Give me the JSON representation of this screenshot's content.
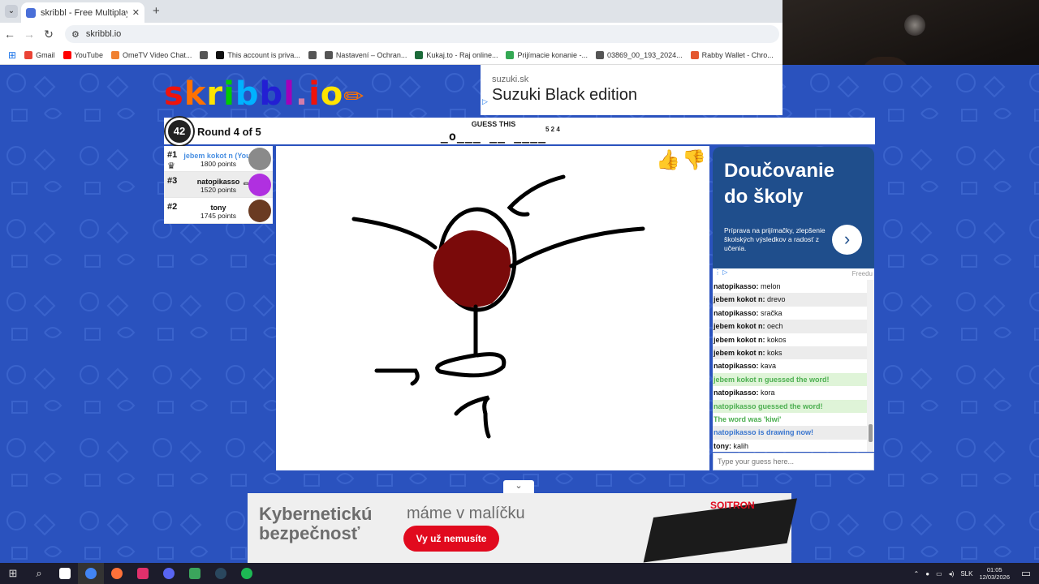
{
  "browser": {
    "tab_title": "skribbl - Free Multiplayer Draw",
    "tab_close": "✕",
    "new_tab": "+",
    "url": "skribbl.io",
    "bookmarks": [
      {
        "label": "Gmail",
        "color": "#ea4335"
      },
      {
        "label": "YouTube",
        "color": "#ff0000"
      },
      {
        "label": "OmeTV Video Chat...",
        "color": "#f08030"
      },
      {
        "label": "",
        "color": "#555555"
      },
      {
        "label": "This account is priva...",
        "color": "#111111"
      },
      {
        "label": "",
        "color": "#555555"
      },
      {
        "label": "Nastavení – Ochran...",
        "color": "#555555"
      },
      {
        "label": "Kukaj.to - Raj online...",
        "color": "#1d6b3a"
      },
      {
        "label": "Prijímacie konanie -...",
        "color": "#34a853"
      },
      {
        "label": "03869_00_193_2024...",
        "color": "#555555"
      },
      {
        "label": "Rabby Wallet - Chro...",
        "color": "#e4572e"
      }
    ]
  },
  "logo": {
    "letters": [
      "s",
      "k",
      "r",
      "i",
      "b",
      "b",
      "l",
      ".",
      "i",
      "o"
    ],
    "pencil": "✏"
  },
  "top_ad": {
    "domain": "suzuki.sk",
    "headline": "Suzuki Black edition"
  },
  "game": {
    "timer": "42",
    "round": "Round 4 of 5",
    "guess_label": "GUESS THIS",
    "word_hint": "_o___ __ ____",
    "word_lengths": "5 2 4"
  },
  "players": [
    {
      "rank": "#1",
      "name": "jebem kokot n (You)",
      "points": "1800 points",
      "avatar_color": "#8a8a8a",
      "is_you": true
    },
    {
      "rank": "#3",
      "name": "natopikasso",
      "points": "1520 points",
      "avatar_color": "#b030e0",
      "is_you": false
    },
    {
      "rank": "#2",
      "name": "tony",
      "points": "1745 points",
      "avatar_color": "#6a3b22",
      "is_you": false
    }
  ],
  "side_ad": {
    "headline": "Doučovanie do školy",
    "subtext": "Príprava na prijímačky, zlepšenie školských výsledkov a radosť z učenia.",
    "go": "›",
    "footer": "Freedu"
  },
  "chat": [
    {
      "name": "natopikasso:",
      "text": " melon",
      "type": "normal"
    },
    {
      "name": "jebem kokot n:",
      "text": " drevo",
      "type": "normal"
    },
    {
      "name": "natopikasso:",
      "text": " sračka",
      "type": "normal"
    },
    {
      "name": "jebem kokot n:",
      "text": " oech",
      "type": "normal"
    },
    {
      "name": "jebem kokot n:",
      "text": " kokos",
      "type": "normal"
    },
    {
      "name": "jebem kokot n:",
      "text": " koks",
      "type": "normal"
    },
    {
      "name": "natopikasso:",
      "text": " kava",
      "type": "normal"
    },
    {
      "name": "",
      "text": "jebem kokot n guessed the word!",
      "type": "correct"
    },
    {
      "name": "natopikasso:",
      "text": " kora",
      "type": "normal"
    },
    {
      "name": "",
      "text": "natopikasso guessed the word!",
      "type": "correct"
    },
    {
      "name": "",
      "text": "The word was 'kiwi'",
      "type": "reveal"
    },
    {
      "name": "",
      "text": "natopikasso is drawing now!",
      "type": "info"
    },
    {
      "name": "tony:",
      "text": " kalih",
      "type": "normal"
    }
  ],
  "guess_input": {
    "placeholder": "Type your guess here..."
  },
  "bottom_ad": {
    "headline": "Kybernetickú bezpečnosť",
    "tagline": "máme v malíčku",
    "cta": "Vy už nemusíte",
    "brand": "SOITRON"
  },
  "taskbar": {
    "apps": [
      {
        "name": "start",
        "color": "#ffffff"
      },
      {
        "name": "search",
        "color": "#ffffff"
      },
      {
        "name": "file",
        "color": "#ffffff"
      },
      {
        "name": "chrome",
        "color": "#4285f4"
      },
      {
        "name": "firefox",
        "color": "#ff7139"
      },
      {
        "name": "instagram",
        "color": "#e1306c"
      },
      {
        "name": "discord-bot",
        "color": "#5865f2"
      },
      {
        "name": "app",
        "color": "#3ba55c"
      },
      {
        "name": "steam",
        "color": "#1b2838"
      },
      {
        "name": "spotify",
        "color": "#1db954"
      }
    ],
    "lang": "SLK",
    "time": "01:05",
    "date": "12/03/2026"
  }
}
